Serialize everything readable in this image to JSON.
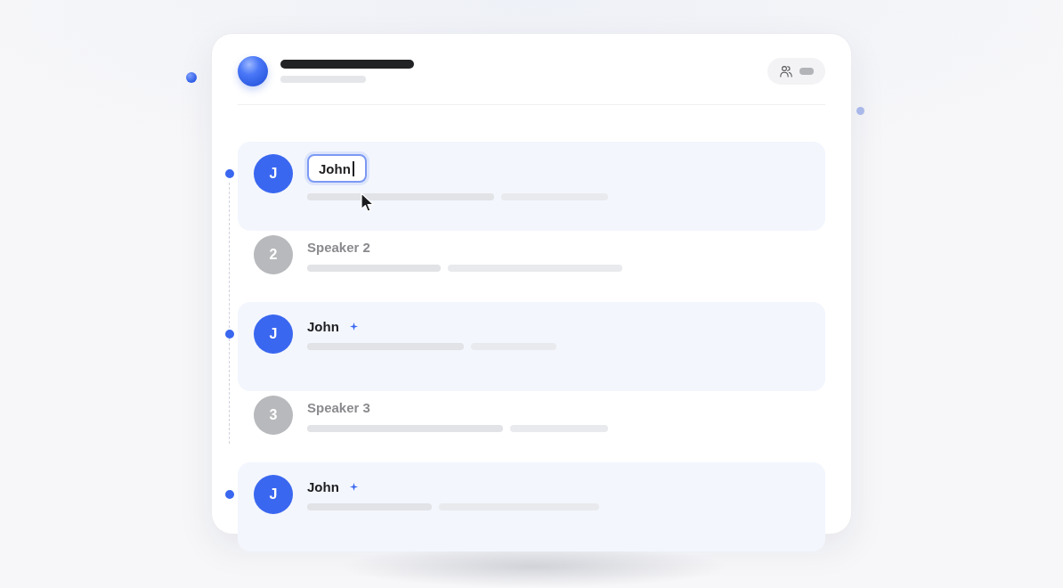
{
  "segments": [
    {
      "kind": "identified",
      "avatar": "J",
      "name": "John",
      "editing": true,
      "auto_labeled": false
    },
    {
      "kind": "unidentified",
      "avatar": "2",
      "name": "Speaker 2",
      "editing": false,
      "auto_labeled": false
    },
    {
      "kind": "identified",
      "avatar": "J",
      "name": "John",
      "editing": false,
      "auto_labeled": true
    },
    {
      "kind": "unidentified",
      "avatar": "3",
      "name": "Speaker 3",
      "editing": false,
      "auto_labeled": false
    },
    {
      "kind": "identified",
      "avatar": "J",
      "name": "John",
      "editing": false,
      "auto_labeled": true
    }
  ]
}
